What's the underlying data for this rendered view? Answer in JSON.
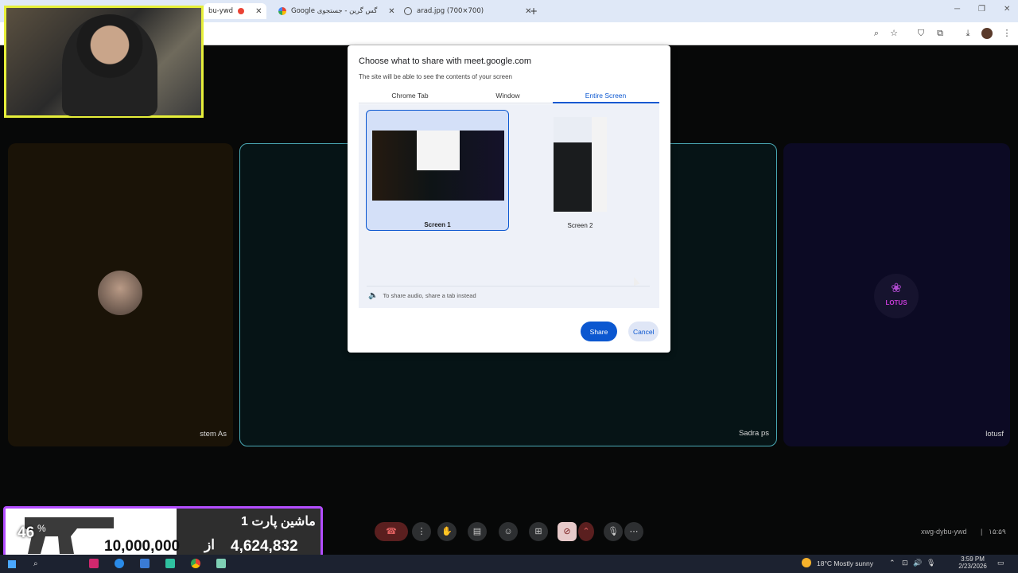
{
  "browser": {
    "tabs": [
      {
        "label": "bu-ywd"
      },
      {
        "label": "Google گس گرین - جستجوی"
      },
      {
        "label": "arad.jpg (700×700)"
      }
    ],
    "new_tab": "+"
  },
  "dialog": {
    "title": "Choose what to share with meet.google.com",
    "subtitle": "The site will be able to see the contents of your screen",
    "tabs": [
      "Chrome Tab",
      "Window",
      "Entire Screen"
    ],
    "selected_tab": "Entire Screen",
    "screens": [
      {
        "label": "Screen 1"
      },
      {
        "label": "Screen 2"
      }
    ],
    "audio_hint": "To share audio, share a tab instead",
    "share": "Share",
    "cancel": "Cancel"
  },
  "meet": {
    "participants": [
      {
        "name": "stem As"
      },
      {
        "name": "Sadra ps"
      },
      {
        "name": "lotusf"
      }
    ],
    "lotus_logo_text": "LOTUS",
    "meeting_code": "xwg-dybu-ywd",
    "clock": "۱۵:۵۹"
  },
  "overlay": {
    "percent": "46",
    "title": "ماشین پارت 1",
    "total": "10,000,000",
    "from": "از",
    "current": "4,624,832"
  },
  "taskbar": {
    "weather": "18°C  Mostly sunny",
    "time": "3:59 PM",
    "date": "2/23/2026"
  }
}
